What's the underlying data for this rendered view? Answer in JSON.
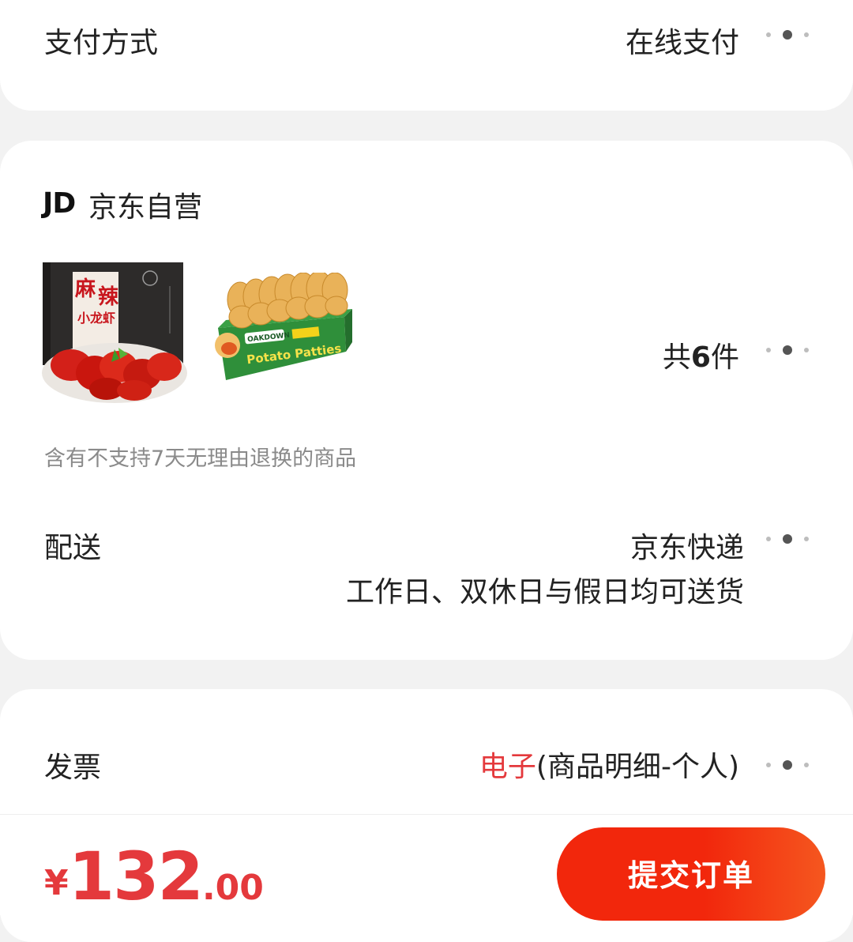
{
  "payment": {
    "label": "支付方式",
    "value": "在线支付"
  },
  "shop": {
    "logo_text": "JD",
    "name": "京东自营",
    "thumb1_text": [
      "麻",
      "辣",
      "小龙虾"
    ],
    "thumb2_brand": "OAKDOWN",
    "thumb2_text": "Potato Patties",
    "count_prefix": "共",
    "count_number": "6",
    "count_suffix": "件",
    "notice": "含有不支持7天无理由退换的商品"
  },
  "delivery": {
    "label": "配送",
    "carrier": "京东快递",
    "schedule": "工作日、双休日与假日均可送货"
  },
  "invoice": {
    "label": "发票",
    "type": "电子",
    "detail": "(商品明细-个人)"
  },
  "footer": {
    "currency": "¥",
    "price_int": "132",
    "price_dec": ".00",
    "submit_label": "提交订单"
  },
  "colors": {
    "accent": "#e4393c",
    "button": "#f2270c"
  }
}
